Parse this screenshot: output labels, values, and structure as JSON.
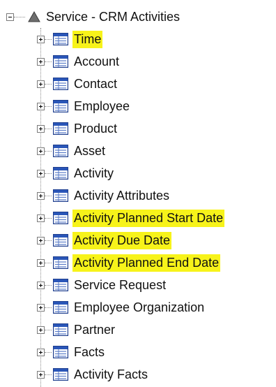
{
  "root": {
    "label": "Service - CRM Activities",
    "expanded": true,
    "icon": "warning-triangle-icon"
  },
  "items": [
    {
      "label": "Time",
      "highlighted": true,
      "icon": "table-icon"
    },
    {
      "label": "Account",
      "highlighted": false,
      "icon": "table-icon"
    },
    {
      "label": "Contact",
      "highlighted": false,
      "icon": "table-icon"
    },
    {
      "label": "Employee",
      "highlighted": false,
      "icon": "table-icon"
    },
    {
      "label": "Product",
      "highlighted": false,
      "icon": "table-icon"
    },
    {
      "label": "Asset",
      "highlighted": false,
      "icon": "table-icon"
    },
    {
      "label": "Activity",
      "highlighted": false,
      "icon": "table-icon"
    },
    {
      "label": "Activity Attributes",
      "highlighted": false,
      "icon": "table-icon"
    },
    {
      "label": "Activity Planned Start Date",
      "highlighted": true,
      "icon": "table-icon"
    },
    {
      "label": "Activity Due Date",
      "highlighted": true,
      "icon": "table-icon"
    },
    {
      "label": "Activity Planned End Date",
      "highlighted": true,
      "icon": "table-icon"
    },
    {
      "label": "Service Request",
      "highlighted": false,
      "icon": "table-icon"
    },
    {
      "label": "Employee Organization",
      "highlighted": false,
      "icon": "table-icon"
    },
    {
      "label": "Partner",
      "highlighted": false,
      "icon": "table-icon"
    },
    {
      "label": "Facts",
      "highlighted": false,
      "icon": "table-icon"
    },
    {
      "label": "Activity Facts",
      "highlighted": false,
      "icon": "table-icon"
    }
  ],
  "colors": {
    "highlight": "#f7f31a",
    "text": "#111111",
    "guide": "#8c8c8c"
  }
}
